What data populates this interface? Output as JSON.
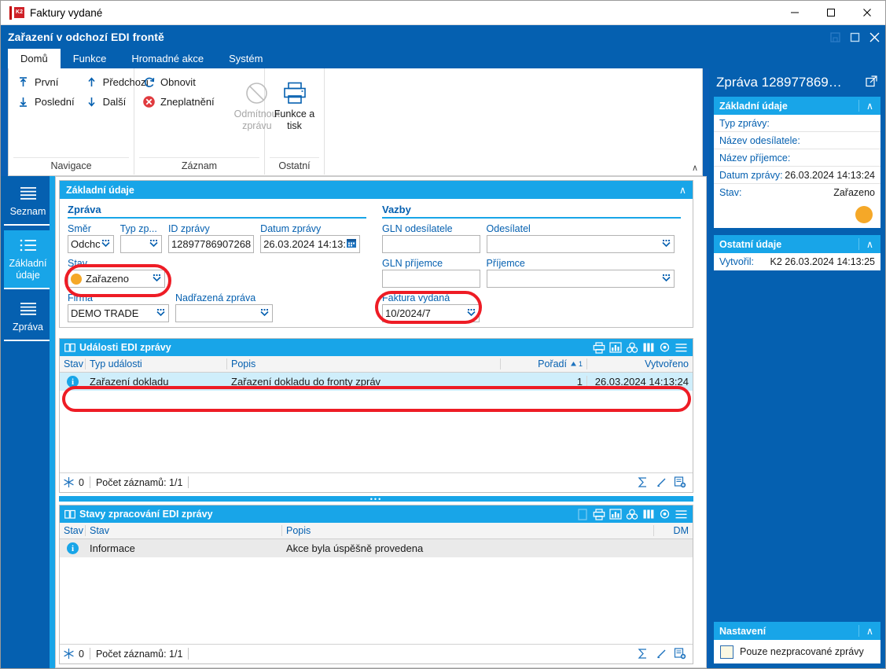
{
  "os_window": {
    "title": "Faktury vydané",
    "app_icon": "k2-logo-icon",
    "minimize": "—",
    "maximize": "☐",
    "close": "✕"
  },
  "mdi_window": {
    "title": "Zařazení v odchozí EDI frontě",
    "save_btn": "⬜",
    "restore_btn": "☐",
    "close_btn": "✕"
  },
  "tabs": [
    {
      "label": "Domů",
      "active": true
    },
    {
      "label": "Funkce",
      "active": false
    },
    {
      "label": "Hromadné akce",
      "active": false
    },
    {
      "label": "Systém",
      "active": false
    }
  ],
  "ribbon": {
    "collapse_caret": "∧",
    "groups": [
      {
        "label": "Navigace",
        "items": [
          {
            "label": "První",
            "icon": "arrow-to-top-icon"
          },
          {
            "label": "Poslední",
            "icon": "arrow-to-bottom-icon"
          },
          {
            "label": "Předchozí",
            "icon": "arrow-up-icon"
          },
          {
            "label": "Další",
            "icon": "arrow-down-icon"
          }
        ]
      },
      {
        "label": "Záznam",
        "items": [
          {
            "label": "Obnovit",
            "icon": "refresh-icon"
          },
          {
            "label": "Zneplatnění",
            "icon": "cancel-red-icon"
          }
        ],
        "big": {
          "label_line1": "Odmítnout",
          "label_line2": "zprávu",
          "icon": "forbidden-icon",
          "disabled": true
        }
      },
      {
        "label": "Ostatní",
        "big": {
          "label_line1": "Funkce a",
          "label_line2": "tisk",
          "icon": "printer-icon",
          "disabled": false
        }
      }
    ]
  },
  "sidebar": {
    "items": [
      {
        "label": "Seznam",
        "icon": "list-lines-icon",
        "active": false
      },
      {
        "label": "Základní\núdaje",
        "label_l1": "Základní",
        "label_l2": "údaje",
        "icon": "bullet-list-icon",
        "active": true
      },
      {
        "label": "Zpráva",
        "icon": "list-lines-icon",
        "active": false
      }
    ]
  },
  "basic_data_panel": {
    "title": "Základní údaje",
    "chevron": "∧",
    "message_group": {
      "title": "Zpráva",
      "fields": [
        {
          "label": "Směr",
          "value": "Odchc",
          "has_dropdown": true
        },
        {
          "label": "Typ zp...",
          "value": "",
          "has_dropdown": true
        },
        {
          "label": "ID zprávy",
          "value": "12897786907268",
          "has_dropdown": false
        },
        {
          "label": "Datum zprávy",
          "value": "26.03.2024 14:13:",
          "has_calendar": true
        },
        {
          "label": "Stav",
          "value": "Zařazeno",
          "has_dropdown": true,
          "dot": "#f5a828",
          "highlighted": true
        },
        {
          "label": "Firma",
          "value": "DEMO TRADE",
          "has_dropdown": true
        },
        {
          "label": "Nadřazená zpráva",
          "value": "",
          "has_dropdown": true
        }
      ]
    },
    "links_group": {
      "title": "Vazby",
      "fields": [
        {
          "label": "GLN odesílatele",
          "value": "",
          "has_dropdown": false
        },
        {
          "label": "Odesílatel",
          "value": "",
          "has_dropdown": true
        },
        {
          "label": "GLN příjemce",
          "value": "",
          "has_dropdown": false
        },
        {
          "label": "Příjemce",
          "value": "",
          "has_dropdown": true
        },
        {
          "label": "Faktura vydaná",
          "value": "10/2024/7",
          "has_dropdown": true,
          "highlighted": true
        }
      ]
    }
  },
  "events_grid": {
    "title": "Události EDI zprávy",
    "toolbar_icons": [
      "print-icon",
      "chart-icon",
      "group-icon",
      "columns-icon",
      "settings-icon",
      "menu-icon"
    ],
    "columns": [
      {
        "label": "Stav",
        "align": "left"
      },
      {
        "label": "Typ události",
        "align": "left"
      },
      {
        "label": "Popis",
        "align": "left"
      },
      {
        "label": "Pořadí",
        "align": "right",
        "sort": "asc",
        "sort_index": "1"
      },
      {
        "label": "Vytvořeno",
        "align": "right"
      }
    ],
    "rows": [
      {
        "state_icon": "info-icon",
        "type": "Zařazení dokladu",
        "description": "Zařazení dokladu do fronty zpráv",
        "order": "1",
        "created": "26.03.2024 14:13:24"
      }
    ],
    "footer": {
      "filter_icon": "snowflake-icon",
      "filter_count": "0",
      "record_count": "Počet záznamů: 1/1",
      "right_icons": [
        "sum-sigma-icon",
        "edit-pencil-icon",
        "new-record-icon"
      ]
    }
  },
  "states_grid": {
    "title": "Stavy zpracování EDI zprávy",
    "toolbar_icons": [
      "doc-icon",
      "print-icon",
      "chart-icon",
      "group-icon",
      "columns-icon",
      "settings-icon",
      "menu-icon"
    ],
    "columns": [
      {
        "label": "Stav",
        "align": "left"
      },
      {
        "label": "Stav",
        "align": "left"
      },
      {
        "label": "Popis",
        "align": "left"
      },
      {
        "label": "DM",
        "align": "right"
      }
    ],
    "rows": [
      {
        "state_icon": "info-icon",
        "state": "Informace",
        "description": "Akce byla úspěšně provedena",
        "dm": ""
      }
    ],
    "footer": {
      "filter_icon": "snowflake-icon",
      "filter_count": "0",
      "record_count": "Počet záznamů: 1/1",
      "right_icons": [
        "sum-sigma-icon",
        "edit-pencil-icon",
        "new-record-icon"
      ]
    }
  },
  "right_panel": {
    "title": "Zpráva 128977869…",
    "expand_icon": "open-external-icon",
    "cards": [
      {
        "title": "Základní údaje",
        "chevron": "∧",
        "rows": [
          {
            "key": "Typ zprávy:",
            "value": ""
          },
          {
            "key": "Název odesílatele:",
            "value": ""
          },
          {
            "key": "Název příjemce:",
            "value": ""
          },
          {
            "key": "Datum zprávy:",
            "value": "26.03.2024 14:13:24"
          },
          {
            "key": "Stav:",
            "value": "Zařazeno"
          }
        ],
        "status_dot": "#f5a828"
      },
      {
        "title": "Ostatní údaje",
        "chevron": "∧",
        "rows": [
          {
            "key": "Vytvořil:",
            "value": "K2 26.03.2024 14:13:25"
          }
        ]
      }
    ],
    "settings_card": {
      "title": "Nastavení",
      "chevron": "∧",
      "checkbox_label": "Pouze nezpracované zprávy",
      "checked": false
    }
  },
  "colors": {
    "brand_blue": "#0560b0",
    "accent_cyan": "#18a5e8",
    "highlight_red": "#ee1c25",
    "status_orange": "#f5a828",
    "row_selected": "#cfeefb"
  }
}
